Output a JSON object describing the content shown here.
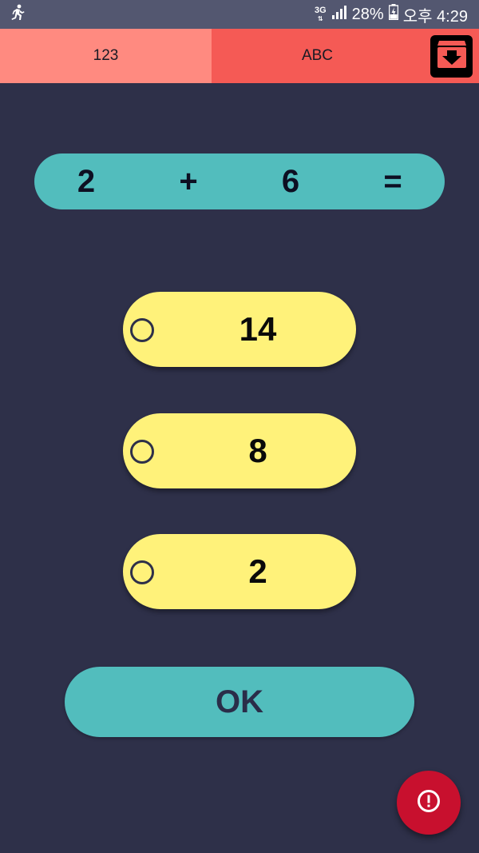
{
  "status_bar": {
    "network": "3G",
    "battery": "28%",
    "time": "오후 4:29"
  },
  "tabs": [
    {
      "label": "123",
      "selected": false
    },
    {
      "label": "ABC",
      "selected": true
    }
  ],
  "archive_button": {
    "icon": "archive-download-icon"
  },
  "equation": {
    "operand1": "2",
    "operator": "+",
    "operand2": "6",
    "equals": "="
  },
  "options": [
    {
      "value": "14",
      "selected": false
    },
    {
      "value": "8",
      "selected": false
    },
    {
      "value": "2",
      "selected": false
    }
  ],
  "ok_button": {
    "label": "OK"
  },
  "fab": {
    "icon": "alert-icon"
  },
  "colors": {
    "background": "#2e3049",
    "status_bar": "#535770",
    "tab_123": "#ff8a80",
    "tab_abc": "#f55a55",
    "teal": "#52bdbd",
    "option_yellow": "#fff27a",
    "fab_red": "#c8102e"
  }
}
